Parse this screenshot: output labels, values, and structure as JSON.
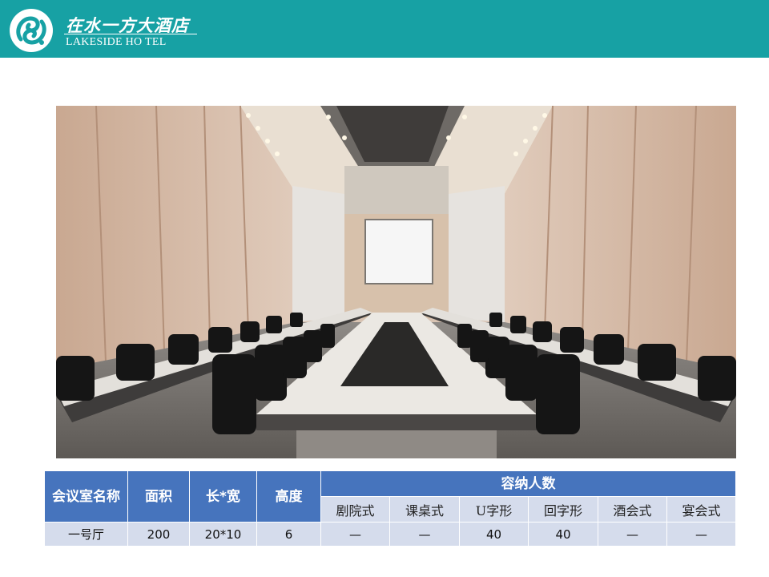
{
  "header": {
    "logo_cn": "在水一方大酒店",
    "logo_en": "LAKESIDE HO TEL",
    "bar_color": "#17a1a4"
  },
  "photo": {
    "icon": "conference-room-photo"
  },
  "table": {
    "header_color": "#4674bd",
    "cell_color": "#d5dcec",
    "headers": {
      "name": "会议室名称",
      "area": "面积",
      "dims": "长*宽",
      "height": "高度",
      "capacity": "容纳人数"
    },
    "capacity_columns": [
      "剧院式",
      "课桌式",
      "U字形",
      "回字形",
      "酒会式",
      "宴会式"
    ],
    "rows": [
      {
        "name": "一号厅",
        "area": "200",
        "dims": "20*10",
        "height": "6",
        "capacity": [
          "—",
          "—",
          "40",
          "40",
          "—",
          "—"
        ]
      }
    ]
  }
}
